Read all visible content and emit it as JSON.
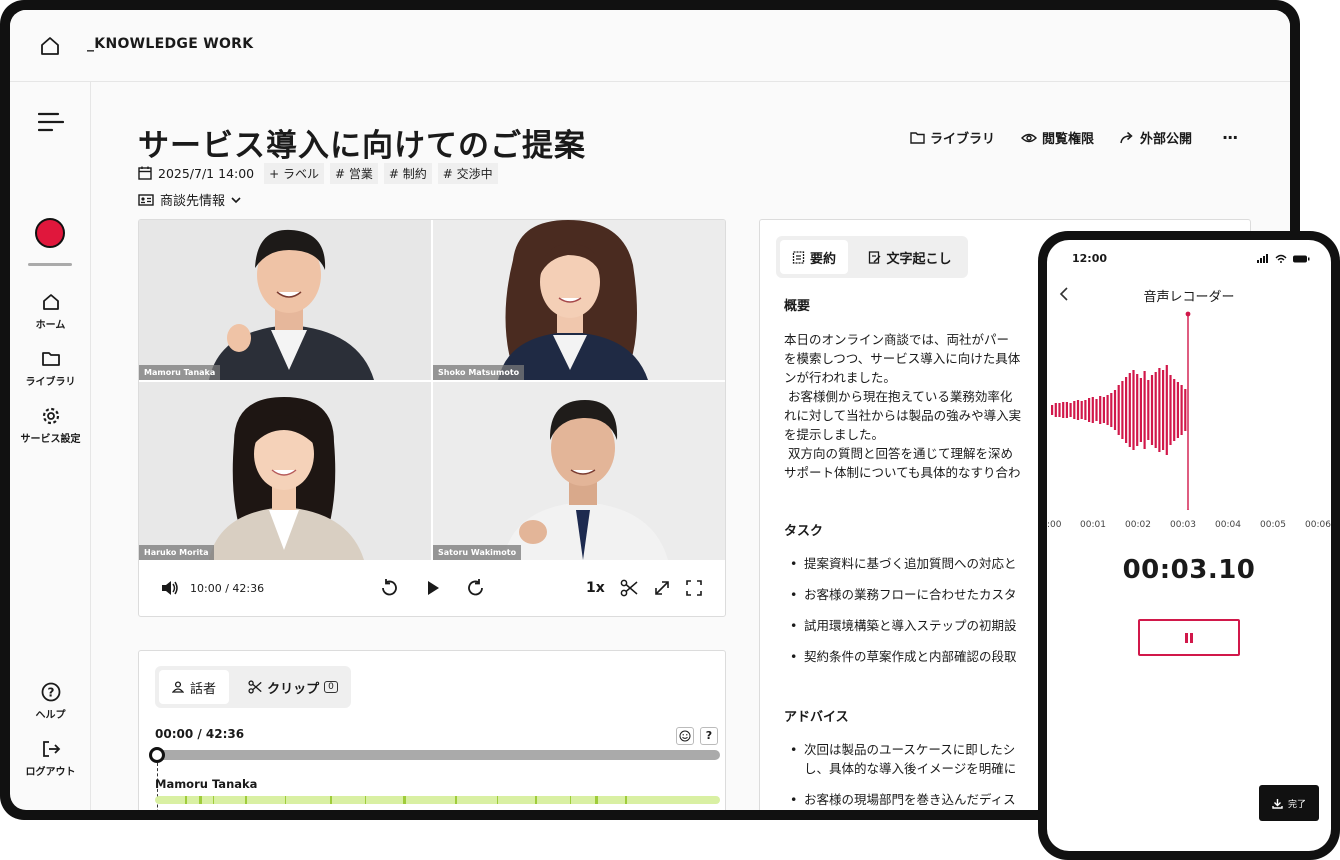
{
  "brand": "_KNOWLEDGE WORK",
  "sidebar": {
    "items": [
      {
        "label": "ホーム"
      },
      {
        "label": "ライブラリ"
      },
      {
        "label": "サービス設定"
      },
      {
        "label": "ヘルプ"
      },
      {
        "label": "ログアウト"
      }
    ]
  },
  "page": {
    "title": "サービス導入に向けてのご提案",
    "datetime": "2025/7/1 14:00",
    "tags": [
      "+ ラベル",
      "# 営業",
      "# 制約",
      "# 交渉中"
    ],
    "deal_info": "商談先情報",
    "actions": [
      "ライブラリ",
      "閲覧権限",
      "外部公開"
    ],
    "more": "···"
  },
  "video": {
    "participants": [
      "Mamoru Tanaka",
      "Shoko Matsumoto",
      "Haruko Morita",
      "Satoru Wakimoto"
    ],
    "time": "10:00 / 42:36",
    "speed": "1x"
  },
  "timeline": {
    "tabs": [
      "話者",
      "クリップ"
    ],
    "clip_count": "0",
    "time": "00:00 / 42:36",
    "help": "?",
    "progress": 0.0,
    "speaker": "Mamoru Tanaka"
  },
  "summary": {
    "tabs": [
      "要約",
      "文字起こし"
    ],
    "overview_heading": "概要",
    "overview_lines": [
      "本日のオンライン商談では、両社がパー",
      "を模索しつつ、サービス導入に向けた具体",
      "ンが行われました。",
      "お客様側から現在抱えている業務効率化",
      "れに対して当社からは製品の強みや導入実",
      "を提示しました。",
      "双方向の質問と回答を通じて理解を深め",
      "サポート体制についても具体的なすり合わ"
    ],
    "task_heading": "タスク",
    "tasks": [
      "提案資料に基づく追加質問への対応と",
      "お客様の業務フローに合わせたカスタ",
      "試用環境構築と導入ステップの初期設",
      "契約条件の草案作成と内部確認の段取"
    ],
    "advice_heading": "アドバイス",
    "advice": [
      "次回は製品のユースケースに即したシ",
      "し、具体的な導入後イメージを明確に",
      "お客様の現場部門を巻き込んだディス"
    ]
  },
  "phone": {
    "status_time": "12:00",
    "title": "音声レコーダー",
    "ticks": [
      ":00",
      "00:01",
      "00:02",
      "00:03",
      "00:04",
      "00:05",
      "00:06"
    ],
    "timer": "00:03.10",
    "done_label": "完了"
  },
  "colors": {
    "record_red": "#e0173c",
    "waveform": "#d1184a",
    "speaker_green": "#d9f0a3"
  }
}
